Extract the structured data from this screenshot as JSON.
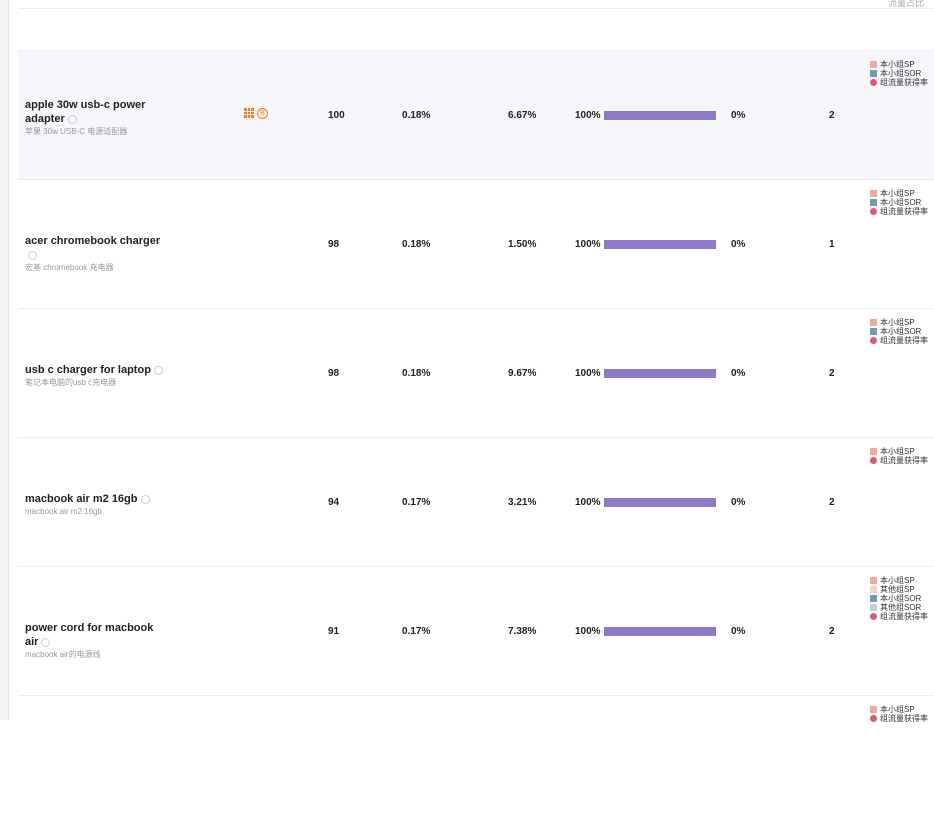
{
  "header": {
    "ghost_text": "流量占比"
  },
  "rows": [
    {
      "keyword": "apple 30w usb-c power adapter",
      "translation": "苹果 30w USB-C 电源适配器",
      "search": "100",
      "share": "0.18%",
      "click": "6.67%",
      "pct": "100%",
      "bar_fraction": 1.0,
      "zero": "0%",
      "num": "2",
      "legend": [
        {
          "label": "本小组SP",
          "color": "#f2aaa0",
          "shape": "square"
        },
        {
          "label": "本小组SOR",
          "color": "#6b9fb3",
          "shape": "square"
        },
        {
          "label": "组流量获得率",
          "color": "#e5567a",
          "shape": "dot"
        }
      ]
    },
    {
      "keyword": "acer chromebook charger",
      "translation": "宏基 chromebook 充电器",
      "search": "98",
      "share": "0.18%",
      "click": "1.50%",
      "pct": "100%",
      "bar_fraction": 1.0,
      "zero": "0%",
      "num": "1",
      "legend": [
        {
          "label": "本小组SP",
          "color": "#f2aaa0",
          "shape": "square"
        },
        {
          "label": "本小组SOR",
          "color": "#6b9fb3",
          "shape": "square"
        },
        {
          "label": "组流量获得率",
          "color": "#e5567a",
          "shape": "dot"
        }
      ]
    },
    {
      "keyword": "usb c charger for laptop",
      "translation": "笔记本电脑的usb c充电器",
      "search": "98",
      "share": "0.18%",
      "click": "9.67%",
      "pct": "100%",
      "bar_fraction": 1.0,
      "zero": "0%",
      "num": "2",
      "legend": [
        {
          "label": "本小组SP",
          "color": "#f2aaa0",
          "shape": "square"
        },
        {
          "label": "本小组SOR",
          "color": "#6b9fb3",
          "shape": "square"
        },
        {
          "label": "组流量获得率",
          "color": "#e5567a",
          "shape": "dot"
        }
      ]
    },
    {
      "keyword": "macbook air m2 16gb",
      "translation": "macbook air m2 16gb",
      "search": "94",
      "share": "0.17%",
      "click": "3.21%",
      "pct": "100%",
      "bar_fraction": 1.0,
      "zero": "0%",
      "num": "2",
      "legend": [
        {
          "label": "本小组SP",
          "color": "#f2aaa0",
          "shape": "square"
        },
        {
          "label": "组流量获得率",
          "color": "#e5567a",
          "shape": "dot"
        }
      ]
    },
    {
      "keyword": "power cord for macbook air",
      "translation": "macbook air的电源线",
      "search": "91",
      "share": "0.17%",
      "click": "7.38%",
      "pct": "100%",
      "bar_fraction": 1.0,
      "zero": "0%",
      "num": "2",
      "legend": [
        {
          "label": "本小组SP",
          "color": "#f2aaa0",
          "shape": "square"
        },
        {
          "label": "其他组SP",
          "color": "#f8d3cd",
          "shape": "square"
        },
        {
          "label": "本小组SOR",
          "color": "#6b9fb3",
          "shape": "square"
        },
        {
          "label": "其他组SOR",
          "color": "#b9d3dd",
          "shape": "square"
        },
        {
          "label": "组流量获得率",
          "color": "#e5567a",
          "shape": "dot"
        }
      ]
    },
    {
      "keyword": "",
      "translation": "",
      "legend": [
        {
          "label": "本小组SP",
          "color": "#f2aaa0",
          "shape": "square"
        },
        {
          "label": "组流量获得率",
          "color": "#e5567a",
          "shape": "dot"
        }
      ]
    }
  ],
  "badge_circle_text": "B"
}
